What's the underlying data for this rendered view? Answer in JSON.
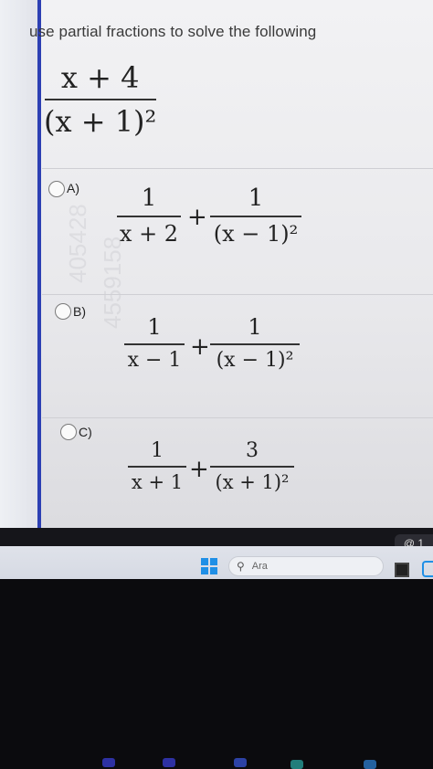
{
  "question": {
    "prompt": "use partial fractions to solve the following",
    "expression": {
      "numerator": "x + 4",
      "denominator": "(x + 1)²"
    }
  },
  "options": [
    {
      "label": "A)",
      "term1": {
        "numerator": "1",
        "denominator": "x + 2"
      },
      "operator": "+",
      "term2": {
        "numerator": "1",
        "denominator": "(x − 1)²"
      }
    },
    {
      "label": "B)",
      "term1": {
        "numerator": "1",
        "denominator": "x − 1"
      },
      "operator": "+",
      "term2": {
        "numerator": "1",
        "denominator": "(x − 1)²"
      }
    },
    {
      "label": "C)",
      "term1": {
        "numerator": "1",
        "denominator": "x + 1"
      },
      "operator": "+",
      "term2": {
        "numerator": "3",
        "denominator": "(x + 1)²"
      }
    }
  ],
  "watermark": {
    "text1": "405428",
    "text2": "4559158"
  },
  "taskbar": {
    "search_placeholder": "Ara",
    "notification_text": "@ 1",
    "icons": [
      "windows-start-icon",
      "search-icon",
      "app-icon",
      "edge-icon"
    ]
  },
  "colors": {
    "accent_line": "#2c3fb3",
    "windows_blue": "#1f8fe6"
  }
}
